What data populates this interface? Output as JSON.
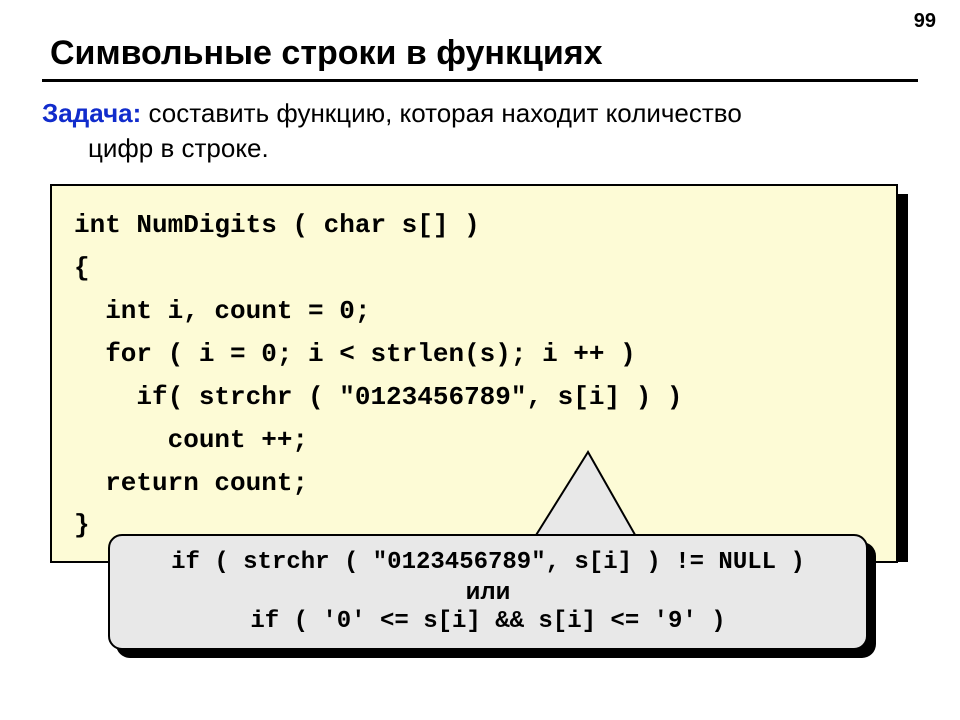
{
  "page_number": "99",
  "title": "Символьные строки в функциях",
  "task": {
    "label": "Задача:",
    "line1": " составить функцию, которая находит количество",
    "line2": "цифр в строке."
  },
  "code": "int NumDigits ( char s[] )\n{\n  int i, count = 0;\n  for ( i = 0; i < strlen(s); i ++ )\n    if( strchr ( \"0123456789\", s[i] ) )\n      count ++;\n  return count;\n}",
  "callout": {
    "line1": "if ( strchr ( \"0123456789\", s[i] ) != NULL )",
    "or": "или",
    "line2": "if ( '0' <= s[i] && s[i] <= '9' )"
  }
}
